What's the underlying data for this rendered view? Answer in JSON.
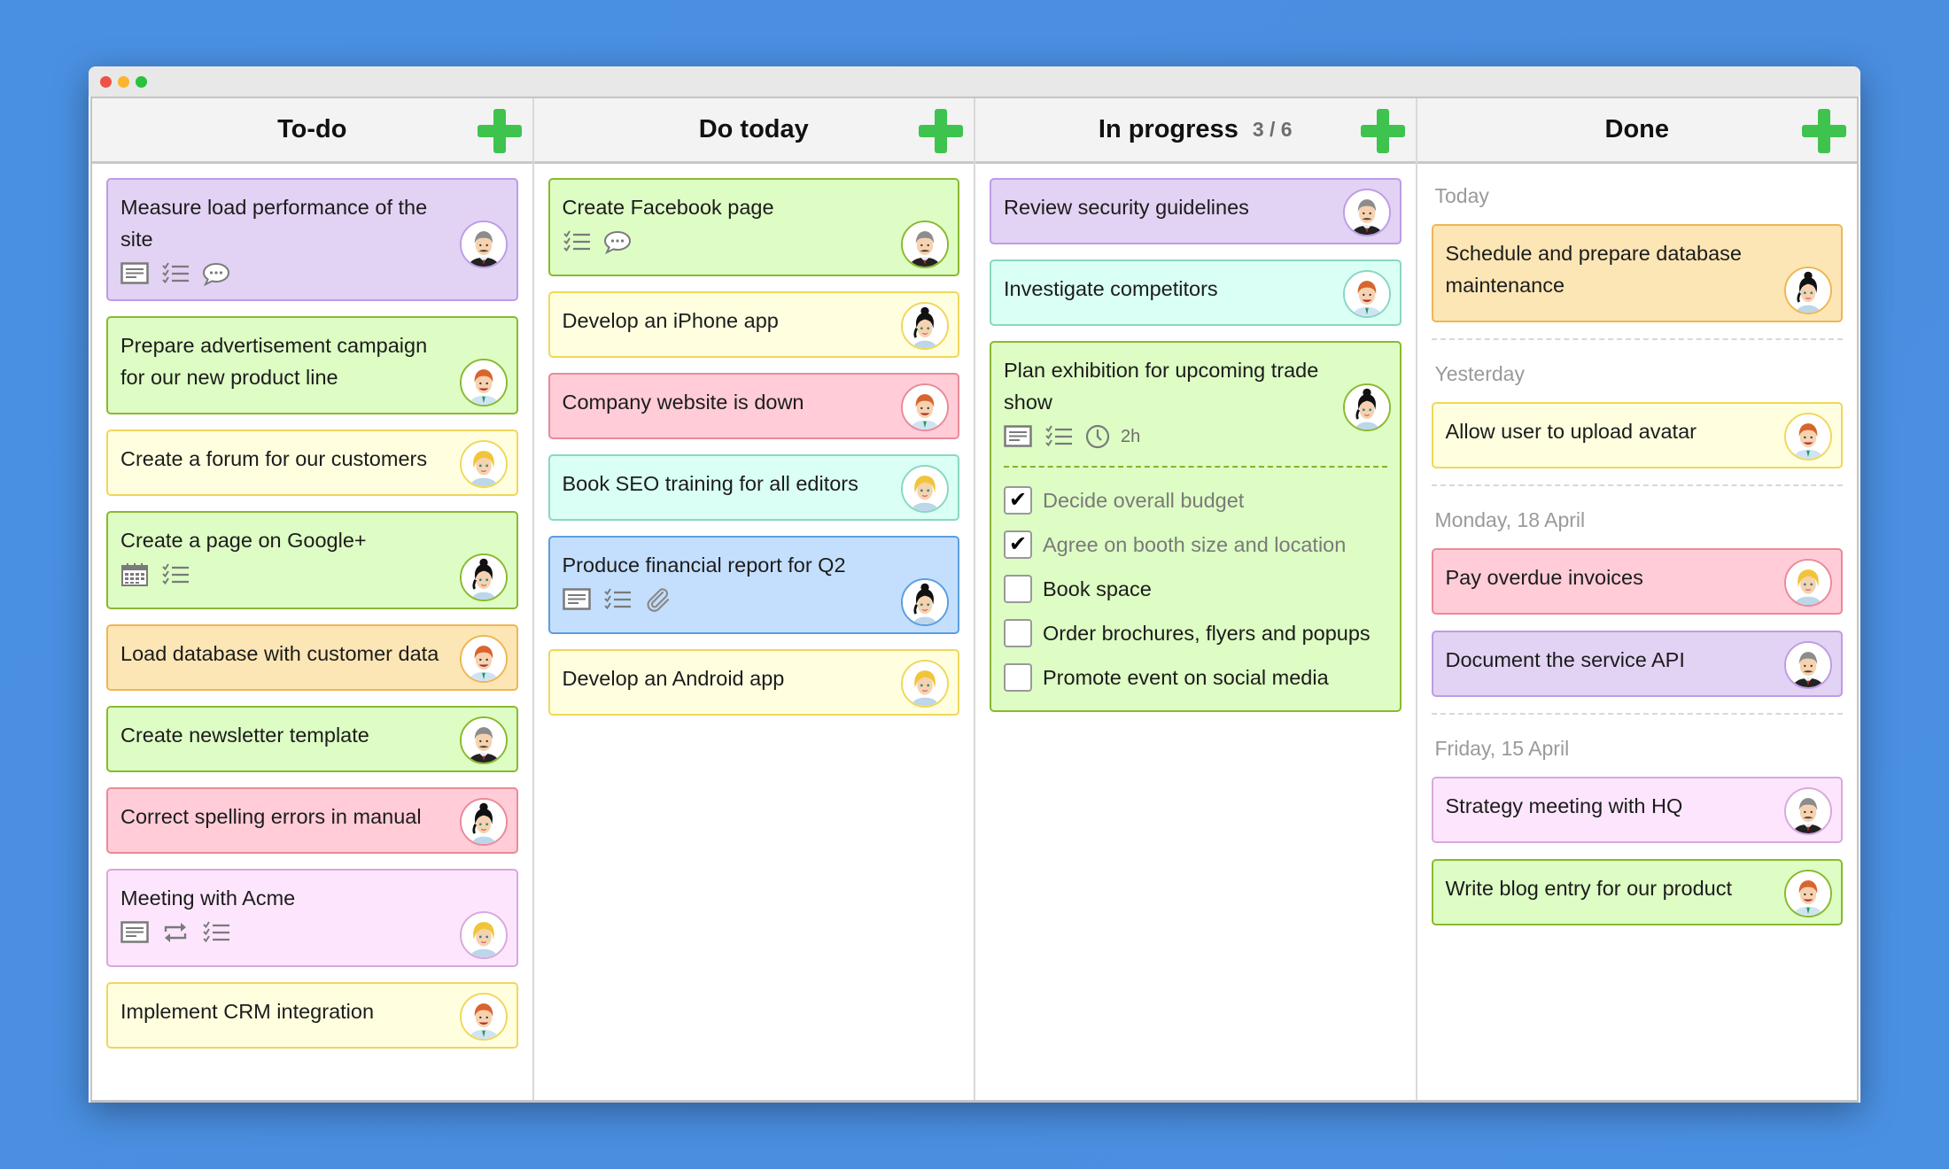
{
  "window": {
    "controls": [
      "close",
      "minimize",
      "maximize"
    ]
  },
  "columns": {
    "todo": {
      "title": "To-do",
      "add_label": "Add card",
      "cards": [
        {
          "title": "Measure load performance of the site",
          "color": "purple",
          "icons": [
            "description-icon",
            "checklist-icon",
            "comment-icon"
          ],
          "avatar": "gray-haired-man"
        },
        {
          "title": "Prepare advertisement campaign for our new product line",
          "color": "green",
          "icons": [],
          "avatar": "red-haired-man"
        },
        {
          "title": "Create a forum for our customers",
          "color": "yellow",
          "icons": [],
          "avatar": "blonde-woman"
        },
        {
          "title": "Create a page on Google+",
          "color": "green",
          "icons": [
            "calendar-icon",
            "checklist-icon"
          ],
          "avatar": "dark-haired-woman"
        },
        {
          "title": "Load database with customer data",
          "color": "orange",
          "icons": [],
          "avatar": "red-haired-man"
        },
        {
          "title": "Create newsletter template",
          "color": "green",
          "icons": [],
          "avatar": "gray-haired-man"
        },
        {
          "title": "Correct spelling errors in manual",
          "color": "red",
          "icons": [],
          "avatar": "dark-haired-woman"
        },
        {
          "title": "Meeting with Acme",
          "color": "pink",
          "icons": [
            "description-icon",
            "repeat-icon",
            "checklist-icon"
          ],
          "avatar": "blonde-woman"
        },
        {
          "title": "Implement CRM integration",
          "color": "yellow",
          "icons": [],
          "avatar": "red-haired-man"
        }
      ]
    },
    "today": {
      "title": "Do today",
      "add_label": "Add card",
      "cards": [
        {
          "title": "Create Facebook page",
          "color": "green",
          "icons": [
            "checklist-icon",
            "comment-icon"
          ],
          "avatar": "gray-haired-man"
        },
        {
          "title": "Develop an iPhone app",
          "color": "yellow",
          "icons": [],
          "avatar": "dark-haired-woman"
        },
        {
          "title": "Company website is down",
          "color": "red",
          "icons": [],
          "avatar": "red-haired-man"
        },
        {
          "title": "Book SEO training for all editors",
          "color": "teal",
          "icons": [],
          "avatar": "blonde-woman"
        },
        {
          "title": "Produce financial report for Q2",
          "color": "blue",
          "icons": [
            "description-icon",
            "checklist-icon",
            "attachment-icon"
          ],
          "avatar": "dark-haired-woman"
        },
        {
          "title": "Develop an Android app",
          "color": "yellow",
          "icons": [],
          "avatar": "blonde-woman"
        }
      ]
    },
    "progress": {
      "title": "In progress",
      "count": "3 / 6",
      "add_label": "Add card",
      "cards": [
        {
          "title": "Review security guidelines",
          "color": "purple",
          "icons": [],
          "avatar": "gray-haired-man"
        },
        {
          "title": "Investigate competitors",
          "color": "teal",
          "icons": [],
          "avatar": "red-haired-man"
        },
        {
          "title": "Plan exhibition for upcoming trade show",
          "color": "green",
          "icons": [
            "description-icon",
            "checklist-icon",
            "clock-icon"
          ],
          "duration": "2h",
          "avatar": "dark-haired-woman",
          "checklist": [
            {
              "label": "Decide overall budget",
              "checked": true
            },
            {
              "label": "Agree on booth size and location",
              "checked": true
            },
            {
              "label": "Book space",
              "checked": false
            },
            {
              "label": "Order brochures, flyers and popups",
              "checked": false
            },
            {
              "label": "Promote event on social media",
              "checked": false
            }
          ]
        }
      ]
    },
    "done": {
      "title": "Done",
      "add_label": "Add card",
      "groups": [
        {
          "label": "Today",
          "cards": [
            {
              "title": "Schedule and prepare database maintenance",
              "color": "orange",
              "avatar": "dark-haired-woman"
            }
          ]
        },
        {
          "label": "Yesterday",
          "cards": [
            {
              "title": "Allow user to upload avatar",
              "color": "yellow",
              "avatar": "red-haired-man"
            }
          ]
        },
        {
          "label": "Monday, 18 April",
          "cards": [
            {
              "title": "Pay overdue invoices",
              "color": "red",
              "avatar": "blonde-woman"
            },
            {
              "title": "Document the service API",
              "color": "purple",
              "avatar": "gray-haired-man"
            }
          ]
        },
        {
          "label": "Friday, 15 April",
          "cards": [
            {
              "title": "Strategy meeting with HQ",
              "color": "pink",
              "avatar": "gray-haired-man"
            },
            {
              "title": "Write blog entry for our product",
              "color": "green",
              "avatar": "red-haired-man"
            }
          ]
        }
      ]
    }
  },
  "colors": {
    "background": "#4a90e2",
    "add_button": "#3ec34f",
    "purple": "#e2d2f3",
    "green": "#ddfdc4",
    "yellow": "#ffffe0",
    "orange": "#fde6b5",
    "red": "#ffccd8",
    "pink": "#fde6fd",
    "teal": "#dafff4",
    "blue": "#c4dffd"
  }
}
